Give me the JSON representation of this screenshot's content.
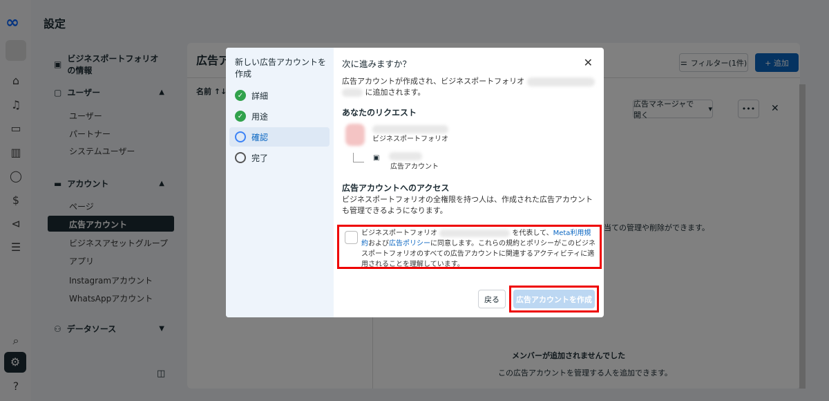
{
  "header": {
    "title": "設定"
  },
  "nav": {
    "business_info": "ビジネスポートフォリオの情報",
    "users_group": "ユーザー",
    "users": [
      "ユーザー",
      "パートナー",
      "システムユーザー"
    ],
    "accounts_group": "アカウント",
    "accounts": [
      "ページ",
      "広告アカウント",
      "ビジネスアセットグループ",
      "アプリ",
      "Instagramアカウント",
      "WhatsAppアカウント"
    ],
    "data_sources": "データソース"
  },
  "main": {
    "title": "広告ア",
    "sort_label": "名前 ↑↓",
    "filter_label": "フィルター(1件)",
    "add_label": "+ 追加",
    "open_ads_manager": "広告マネージャで開く",
    "more": "•••",
    "assign_text": "当ての管理や削除ができます。",
    "empty_title": "メンバーが追加されませんでした",
    "empty_sub": "この広告アカウントを管理する人を追加できます。"
  },
  "modal": {
    "sidebar_title": "新しい広告アカウントを作成",
    "steps": [
      {
        "label": "詳細",
        "state": "done"
      },
      {
        "label": "用途",
        "state": "done"
      },
      {
        "label": "確認",
        "state": "current"
      },
      {
        "label": "完了",
        "state": "todo"
      }
    ],
    "heading": "次に進みますか？",
    "intro_a": "広告アカウントが作成され、ビジネスポートフォリオ",
    "intro_b": "に追加されます。",
    "request_heading": "あなたのリクエスト",
    "portfolio_label": "ビジネスポートフォリオ",
    "ad_account_label": "広告アカウント",
    "access_heading": "広告アカウントへのアクセス",
    "access_text": "ビジネスポートフォリオの全権限を持つ人は、作成された広告アカウントも管理できるようになります。",
    "agree_a": "ビジネスポートフォリオ",
    "agree_b": "を代表して、",
    "terms_link": "Meta利用規約",
    "agree_c": "および",
    "policy_link": "広告ポリシー",
    "agree_d": "に同意します。これらの規約とポリシーがこのビジネスポートフォリオのすべての広告アカウントに関連するアクティビティに適用されることを理解しています。",
    "back_label": "戻る",
    "create_label": "広告アカウントを作成"
  }
}
